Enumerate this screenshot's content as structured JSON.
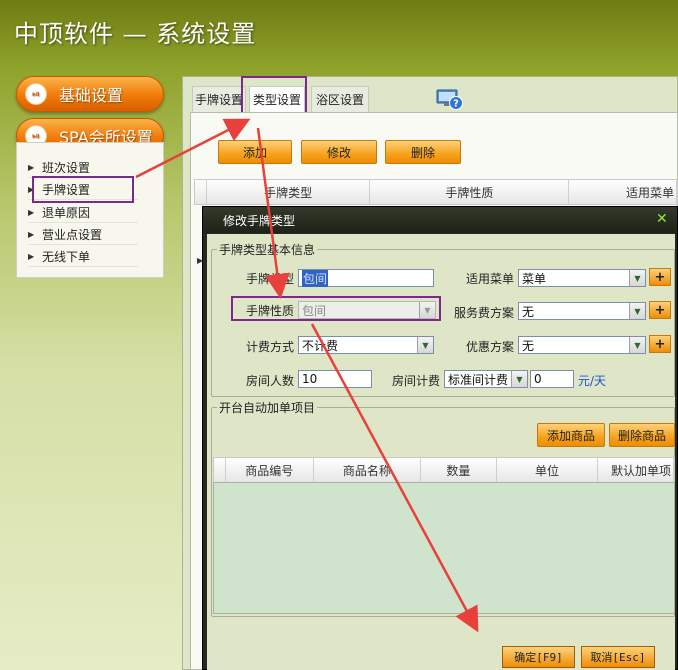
{
  "header": {
    "title": "中顶软件 — 系统设置"
  },
  "sidebar": {
    "sections": [
      {
        "label": "基础设置"
      },
      {
        "label": "SPA会所设置"
      }
    ],
    "items": [
      {
        "label": "班次设置"
      },
      {
        "label": "手牌设置"
      },
      {
        "label": "退单原因"
      },
      {
        "label": "营业点设置"
      },
      {
        "label": "无线下单"
      }
    ]
  },
  "tabs": [
    {
      "label": "手牌设置"
    },
    {
      "label": "类型设置"
    },
    {
      "label": "浴区设置"
    }
  ],
  "toolbar": {
    "add": "添加",
    "edit": "修改",
    "delete": "删除"
  },
  "grid": {
    "columns": [
      "手牌类型",
      "手牌性质",
      "适用菜单"
    ]
  },
  "modal": {
    "title": "修改手牌类型",
    "basic_group": "手牌类型基本信息",
    "fields": {
      "type_label": "手牌类型",
      "type_value": "包间",
      "menu_label": "适用菜单",
      "menu_value": "菜单",
      "nature_label": "手牌性质",
      "nature_value": "包间",
      "service_label": "服务费方案",
      "service_value": "无",
      "billing_label": "计费方式",
      "billing_value": "不计费",
      "discount_label": "优惠方案",
      "discount_value": "无",
      "capacity_label": "房间人数",
      "capacity_value": "10",
      "roomfee_label": "房间计费",
      "roomfee_value": "标准间计费",
      "roomfee_amount": "0",
      "roomfee_unit": "元/天"
    },
    "auto_group": "开台自动加单项目",
    "add_item": "添加商品",
    "delete_item": "删除商品",
    "item_columns": [
      "商品编号",
      "商品名称",
      "数量",
      "单位",
      "默认加单项"
    ],
    "ok": "确定[F9]",
    "cancel": "取消[Esc]"
  },
  "colors": {
    "accent": "#f07a08",
    "annotation": "#7b2a8c",
    "arrow": "#e8403a"
  }
}
